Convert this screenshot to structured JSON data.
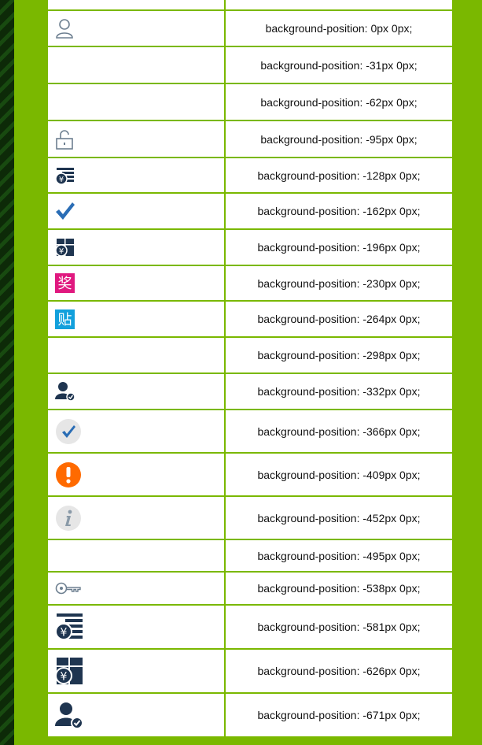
{
  "header": {
    "icon_col": "",
    "code_col": ""
  },
  "rows": [
    {
      "icon": "user-outline-icon",
      "code": "background-position: 0px 0px;"
    },
    {
      "icon": "",
      "code": "background-position: -31px 0px;"
    },
    {
      "icon": "",
      "code": "background-position: -62px 0px;"
    },
    {
      "icon": "lock-icon",
      "code": "background-position: -95px 0px;"
    },
    {
      "icon": "yen-list-small-icon",
      "code": "background-position: -128px 0px;"
    },
    {
      "icon": "check-icon",
      "code": "background-position: -162px 0px;"
    },
    {
      "icon": "yen-grid-small-icon",
      "code": "background-position: -196px 0px;"
    },
    {
      "icon": "jiang-badge-icon",
      "badge_text": "奖",
      "code": "background-position: -230px 0px;"
    },
    {
      "icon": "tie-badge-icon",
      "badge_text": "贴",
      "code": "background-position: -264px 0px;"
    },
    {
      "icon": "",
      "code": "background-position: -298px 0px;"
    },
    {
      "icon": "user-check-small-icon",
      "code": "background-position: -332px 0px;"
    },
    {
      "icon": "check-circle-icon",
      "code": "background-position: -366px 0px;"
    },
    {
      "icon": "warning-circle-icon",
      "code": "background-position: -409px 0px;"
    },
    {
      "icon": "info-circle-icon",
      "code": "background-position: -452px 0px;"
    },
    {
      "icon": "",
      "code": "background-position: -495px 0px;"
    },
    {
      "icon": "key-icon",
      "code": "background-position: -538px 0px;"
    },
    {
      "icon": "yen-list-large-icon",
      "code": "background-position: -581px 0px;"
    },
    {
      "icon": "yen-grid-large-icon",
      "code": "background-position: -626px 0px;"
    },
    {
      "icon": "user-check-large-icon",
      "code": "background-position: -671px 0px;"
    }
  ],
  "colors": {
    "page_bg": "#7ab800",
    "icon_navy": "#1f3550",
    "check_blue": "#2a6db5",
    "jiang_pink": "#e0187f",
    "tie_blue": "#12a0dc",
    "warning_orange": "#ff6a00",
    "light_gray": "#e6e6e6",
    "info_gray": "#8a9aa8"
  }
}
